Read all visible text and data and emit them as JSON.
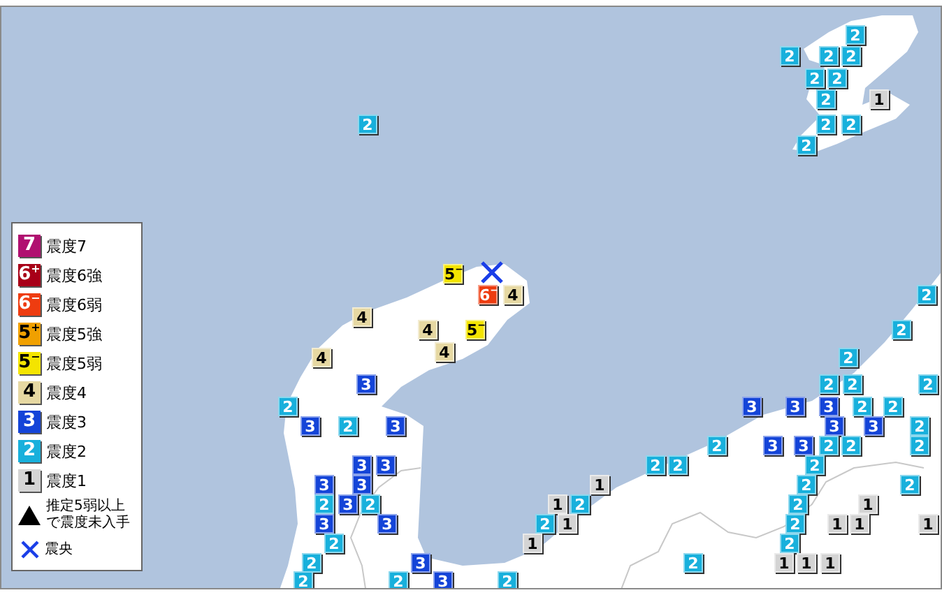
{
  "legend": {
    "items": [
      {
        "kind": "s7",
        "symbol": "7",
        "label": "震度7"
      },
      {
        "kind": "s6u",
        "symbol": "6$^{+}$",
        "label": "震度6強"
      },
      {
        "kind": "s6l",
        "symbol": "6$^{−}$",
        "label": "震度6弱"
      },
      {
        "kind": "s5u",
        "symbol": "5$^{+}$",
        "label": "震度5強"
      },
      {
        "kind": "s5l",
        "symbol": "5$^{−}$",
        "label": "震度5弱"
      },
      {
        "kind": "s4",
        "symbol": "4",
        "label": "震度4"
      },
      {
        "kind": "s3",
        "symbol": "3",
        "label": "震度3"
      },
      {
        "kind": "s2",
        "symbol": "2",
        "label": "震度2"
      },
      {
        "kind": "s1",
        "symbol": "1",
        "label": "震度1"
      },
      {
        "kind": "unreported",
        "label": "推定5弱以上で震度未入手"
      },
      {
        "kind": "epicenter",
        "label": "震央"
      }
    ]
  },
  "markers": [
    {
      "kind": "s2",
      "label": "2"
    },
    {
      "kind": "s2",
      "label": "2"
    },
    {
      "kind": "s2",
      "label": "2"
    },
    {
      "kind": "s2",
      "label": "2"
    },
    {
      "kind": "s2",
      "label": "2"
    },
    {
      "kind": "s2",
      "label": "2"
    },
    {
      "kind": "s2",
      "label": "2"
    },
    {
      "kind": "s1",
      "label": "1"
    },
    {
      "kind": "s2",
      "label": "2"
    },
    {
      "kind": "s2",
      "label": "2"
    },
    {
      "kind": "s2",
      "label": "2"
    },
    {
      "kind": "s2",
      "label": "2"
    },
    {
      "kind": "s5l",
      "label": "5$^{−}$"
    },
    {
      "kind": "s6l",
      "label": "6$^{−}$"
    },
    {
      "kind": "s4",
      "label": "4"
    },
    {
      "kind": "s2",
      "label": "2"
    },
    {
      "kind": "s4",
      "label": "4"
    },
    {
      "kind": "s4",
      "label": "4"
    },
    {
      "kind": "s5l",
      "label": "5$^{−}$"
    },
    {
      "kind": "s2",
      "label": "2"
    },
    {
      "kind": "s4",
      "label": "4"
    },
    {
      "kind": "s4",
      "label": "4"
    },
    {
      "kind": "s2",
      "label": "2"
    },
    {
      "kind": "s3",
      "label": "3"
    },
    {
      "kind": "s2",
      "label": "2"
    },
    {
      "kind": "s2",
      "label": "2"
    },
    {
      "kind": "s2",
      "label": "2"
    },
    {
      "kind": "s2",
      "label": "2"
    },
    {
      "kind": "s3",
      "label": "3"
    },
    {
      "kind": "s3",
      "label": "3"
    },
    {
      "kind": "s3",
      "label": "3"
    },
    {
      "kind": "s2",
      "label": "2"
    },
    {
      "kind": "s2",
      "label": "2"
    },
    {
      "kind": "s3",
      "label": "3"
    },
    {
      "kind": "s2",
      "label": "2"
    },
    {
      "kind": "s3",
      "label": "3"
    },
    {
      "kind": "s3",
      "label": "3"
    },
    {
      "kind": "s3",
      "label": "3"
    },
    {
      "kind": "s2",
      "label": "2"
    },
    {
      "kind": "s2",
      "label": "2"
    },
    {
      "kind": "s3",
      "label": "3"
    },
    {
      "kind": "s3",
      "label": "3"
    },
    {
      "kind": "s2",
      "label": "2"
    },
    {
      "kind": "s2",
      "label": "2"
    },
    {
      "kind": "s2",
      "label": "2"
    },
    {
      "kind": "s3",
      "label": "3"
    },
    {
      "kind": "s3",
      "label": "3"
    },
    {
      "kind": "s2",
      "label": "2"
    },
    {
      "kind": "s2",
      "label": "2"
    },
    {
      "kind": "s2",
      "label": "2"
    },
    {
      "kind": "s3",
      "label": "3"
    },
    {
      "kind": "s3",
      "label": "3"
    },
    {
      "kind": "s1",
      "label": "1"
    },
    {
      "kind": "s2",
      "label": "2"
    },
    {
      "kind": "s2",
      "label": "2"
    },
    {
      "kind": "s2",
      "label": "2"
    },
    {
      "kind": "s3",
      "label": "3"
    },
    {
      "kind": "s2",
      "label": "2"
    },
    {
      "kind": "s1",
      "label": "1"
    },
    {
      "kind": "s2",
      "label": "2"
    },
    {
      "kind": "s2",
      "label": "2"
    },
    {
      "kind": "s1",
      "label": "1"
    },
    {
      "kind": "s3",
      "label": "3"
    },
    {
      "kind": "s3",
      "label": "3"
    },
    {
      "kind": "s2",
      "label": "2"
    },
    {
      "kind": "s1",
      "label": "1"
    },
    {
      "kind": "s2",
      "label": "2"
    },
    {
      "kind": "s1",
      "label": "1"
    },
    {
      "kind": "s1",
      "label": "1"
    },
    {
      "kind": "s1",
      "label": "1"
    },
    {
      "kind": "s2",
      "label": "2"
    },
    {
      "kind": "s1",
      "label": "1"
    },
    {
      "kind": "s2",
      "label": "2"
    },
    {
      "kind": "s2",
      "label": "2"
    },
    {
      "kind": "s3",
      "label": "3"
    },
    {
      "kind": "s2",
      "label": "2"
    },
    {
      "kind": "s1",
      "label": "1"
    },
    {
      "kind": "s1",
      "label": "1"
    },
    {
      "kind": "s1",
      "label": "1"
    },
    {
      "kind": "s2",
      "label": "2"
    },
    {
      "kind": "s2",
      "label": "2"
    },
    {
      "kind": "s3",
      "label": "3"
    },
    {
      "kind": "s2",
      "label": "2"
    }
  ]
}
